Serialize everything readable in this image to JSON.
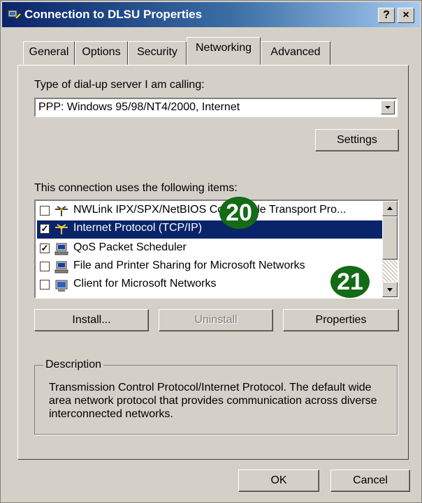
{
  "window": {
    "title": "Connection to DLSU Properties",
    "help_button": "?",
    "close_button": "×"
  },
  "tabs": [
    {
      "label": "General"
    },
    {
      "label": "Options"
    },
    {
      "label": "Security"
    },
    {
      "label": "Networking"
    },
    {
      "label": "Advanced"
    }
  ],
  "networking": {
    "server_type_label": "Type of dial-up server I am calling:",
    "server_type_value": "PPP: Windows 95/98/NT4/2000, Internet",
    "settings_button": "Settings",
    "items_label": "This connection uses the following items:",
    "items": [
      {
        "label": "NWLink IPX/SPX/NetBIOS Compatible Transport Pro...",
        "checked": false,
        "selected": false,
        "icon": "protocol-icon"
      },
      {
        "label": "Internet Protocol (TCP/IP)",
        "checked": true,
        "selected": true,
        "icon": "protocol-icon"
      },
      {
        "label": "QoS Packet Scheduler",
        "checked": true,
        "selected": false,
        "icon": "service-icon"
      },
      {
        "label": "File and Printer Sharing for Microsoft Networks",
        "checked": false,
        "selected": false,
        "icon": "service-icon"
      },
      {
        "label": "Client for Microsoft Networks",
        "checked": false,
        "selected": false,
        "icon": "client-icon"
      }
    ],
    "install_button": "Install...",
    "uninstall_button": "Uninstall",
    "properties_button": "Properties",
    "description_legend": "Description",
    "description_text": "Transmission Control Protocol/Internet Protocol. The default wide area network protocol that provides communication across diverse interconnected networks."
  },
  "footer": {
    "ok_button": "OK",
    "cancel_button": "Cancel"
  },
  "annotations": [
    {
      "label": "20",
      "color": "#136b16"
    },
    {
      "label": "21",
      "color": "#136b16"
    }
  ]
}
